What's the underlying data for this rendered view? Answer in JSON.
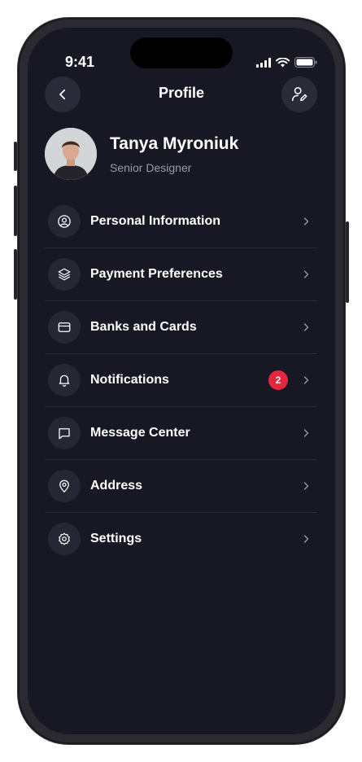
{
  "status_bar": {
    "time": "9:41"
  },
  "header": {
    "title": "Profile",
    "back_icon": "chevron-left-icon",
    "edit_icon": "user-edit-icon"
  },
  "profile": {
    "name": "Tanya Myroniuk",
    "role": "Senior Designer"
  },
  "menu": {
    "items": [
      {
        "label": "Personal Information",
        "icon": "user-circle-icon"
      },
      {
        "label": "Payment Preferences",
        "icon": "layers-icon"
      },
      {
        "label": "Banks and Cards",
        "icon": "credit-card-icon"
      },
      {
        "label": "Notifications",
        "icon": "bell-icon",
        "badge": "2"
      },
      {
        "label": "Message Center",
        "icon": "message-icon"
      },
      {
        "label": "Address",
        "icon": "location-pin-icon"
      },
      {
        "label": "Settings",
        "icon": "gear-icon"
      }
    ]
  },
  "colors": {
    "background": "#181824",
    "badge": "#e8253f",
    "secondary_text": "#9a9ba6"
  }
}
